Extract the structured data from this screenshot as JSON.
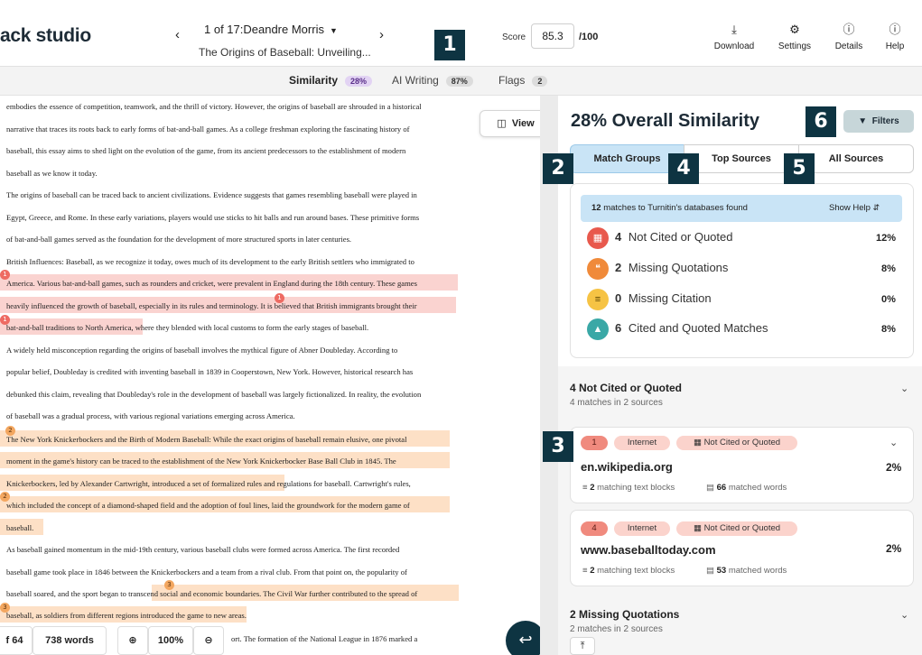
{
  "header": {
    "brand": "ack studio",
    "submission_name": "1 of 17:Deandre Morris",
    "submission_title": "The Origins of Baseball: Unveiling...",
    "score_label": "Score",
    "score_value": "85.3",
    "score_max": "/100",
    "tools": [
      {
        "label": "Download",
        "icon": "download-icon"
      },
      {
        "label": "Settings",
        "icon": "gear-icon"
      },
      {
        "label": "Details",
        "icon": "info-icon"
      },
      {
        "label": "Help",
        "icon": "help-icon"
      }
    ]
  },
  "markers": [
    "1",
    "2",
    "3",
    "4",
    "5",
    "6"
  ],
  "tabs": [
    {
      "label": "Similarity",
      "badge": "28%",
      "active": true
    },
    {
      "label": "AI Writing",
      "badge": "87%",
      "active": false
    },
    {
      "label": "Flags",
      "badge": "2",
      "active": false
    }
  ],
  "document": {
    "view_label": "View",
    "lines": [
      "embodies the essence of competition, teamwork, and the thrill of victory. However, the origins of baseball are shrouded in a historical",
      "narrative that traces its roots back to early forms of bat-and-ball games. As a college freshman exploring the fascinating history of",
      "baseball, this essay aims to shed light on the evolution of the game, from its ancient predecessors to the establishment of modern",
      "baseball as we know it today.",
      "    The origins of baseball can be traced back to ancient civilizations. Evidence suggests that games resembling baseball were played in",
      "Egypt, Greece, and Rome. In these early variations, players would use sticks to hit balls and run around bases. These primitive forms",
      "of bat-and-ball games served as the foundation for the development of more structured sports in later centuries.",
      "British Influences: Baseball, as we recognize it today, owes much of its development to the early British settlers who immigrated to",
      "America. Various bat-and-ball games, such as rounders and cricket, were prevalent in England during the 18th century. These games",
      "heavily influenced the growth of baseball, especially in its rules and terminology. It is believed that British immigrants brought their",
      "bat-and-ball traditions to North America, where they blended with local customs to form the early stages of baseball.",
      "    A widely held misconception regarding the origins of baseball involves the mythical figure of Abner Doubleday. According to",
      "popular belief, Doubleday is credited with inventing baseball in 1839 in Cooperstown, New York. However, historical research has",
      "debunked this claim, revealing that Doubleday's role in the development of baseball was largely fictionalized. In reality, the evolution",
      "of baseball was a gradual process, with various regional variations emerging across America.",
      "    The New York Knickerbockers and the Birth of Modern Baseball: While the exact origins of baseball remain elusive, one pivotal",
      "moment in the game's history can be traced to the establishment of the New York Knickerbocker Base Ball Club in 1845. The",
      "Knickerbockers, led by Alexander Cartwright, introduced a set of formalized rules and regulations for baseball. Cartwright's rules,",
      "which included the concept of a diamond-shaped field and the adoption of foul lines, laid the groundwork for the modern game of",
      "baseball.",
      "    As baseball gained momentum in the mid-19th century, various baseball clubs were formed across America. The first recorded",
      "baseball game took place in 1846 between the Knickerbockers and a team from a rival club. From that point on, the popularity of",
      "baseball soared, and the sport began to transcend social and economic boundaries. The Civil War further contributed to the spread of",
      "baseball, as soldiers from different regions introduced the game to new areas.",
      "ort. The formation of the National League in 1876 marked a"
    ],
    "match_numbers": [
      "1",
      "1",
      "1",
      "2",
      "2",
      "3",
      "3"
    ],
    "page_label": "f 64",
    "word_count": "738 words",
    "zoom": "100%"
  },
  "panel": {
    "title": "28% Overall Similarity",
    "filters_label": "Filters",
    "segments": [
      "Match Groups",
      "Top Sources",
      "All Sources"
    ],
    "info_count": "12",
    "info_text": "matches to Turnitin's databases found",
    "show_help": "Show Help",
    "groups": [
      {
        "count": "4",
        "label": "Not Cited or Quoted",
        "pct": "12%",
        "color": "#e8594d",
        "icon": "document-icon"
      },
      {
        "count": "2",
        "label": "Missing Quotations",
        "pct": "8%",
        "color": "#f08a3a",
        "icon": "quote-icon"
      },
      {
        "count": "0",
        "label": "Missing Citation",
        "pct": "0%",
        "color": "#f6c344",
        "icon": "lines-icon"
      },
      {
        "count": "6",
        "label": "Cited and Quoted Matches",
        "pct": "8%",
        "color": "#3aa8a6",
        "icon": "graduation-cap-icon"
      }
    ],
    "section1": {
      "title": "4  Not Cited or Quoted",
      "subtitle": "4 matches in 2 sources"
    },
    "sources": [
      {
        "num": "1",
        "type": "Internet",
        "status": "Not Cited or Quoted",
        "name": "en.wikipedia.org",
        "pct": "2%",
        "blocks": "2",
        "blocks_label": "matching text blocks",
        "words": "66",
        "words_label": "matched words"
      },
      {
        "num": "4",
        "type": "Internet",
        "status": "Not Cited or Quoted",
        "name": "www.baseballtoday.com",
        "pct": "2%",
        "blocks": "2",
        "blocks_label": "matching text blocks",
        "words": "53",
        "words_label": "matched words"
      }
    ],
    "section2": {
      "title": "2  Missing Quotations",
      "subtitle": "2 matches in 2 sources"
    }
  }
}
